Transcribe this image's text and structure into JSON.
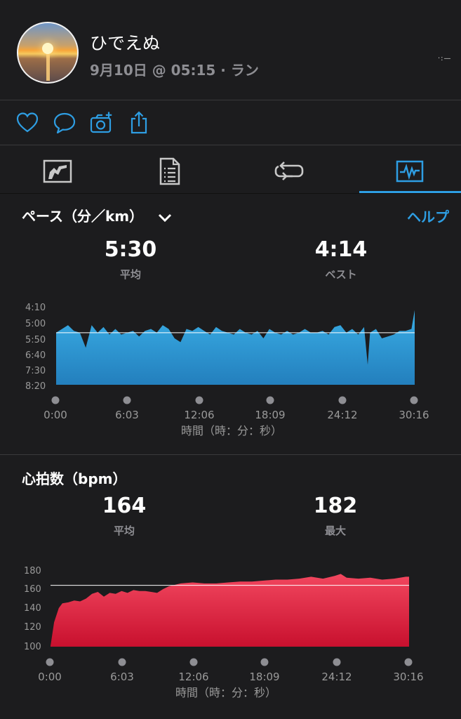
{
  "profile": {
    "name": "ひでえぬ",
    "meta": "9月10日 @ 05:15 · ラン",
    "more": "·:—"
  },
  "actions": [
    "heart-icon",
    "comment-icon",
    "add-photo-icon",
    "share-icon"
  ],
  "tabs": [
    {
      "icon": "map-summary-icon",
      "selected": false
    },
    {
      "icon": "details-icon",
      "selected": false
    },
    {
      "icon": "laps-icon",
      "selected": false
    },
    {
      "icon": "charts-icon",
      "selected": true
    }
  ],
  "colors": {
    "accent": "#2e9ee3",
    "pace": "#2f9fd6",
    "heart": "#e8304e"
  },
  "pace": {
    "title": "ペース（分／km）",
    "help": "ヘルプ",
    "avg_value": "5:30",
    "avg_label": "平均",
    "best_value": "4:14",
    "best_label": "ベスト"
  },
  "heart": {
    "title": "心拍数（bpm）",
    "avg_value": "164",
    "avg_label": "平均",
    "max_value": "182",
    "max_label": "最大"
  },
  "chart_data": [
    {
      "type": "area",
      "title": "ペース（分／km）",
      "y_tick_labels": [
        "4:10",
        "5:00",
        "5:50",
        "6:40",
        "7:30",
        "8:20"
      ],
      "x_tick_labels": [
        "0:00",
        "6:03",
        "12:06",
        "18:09",
        "24:12",
        "30:16"
      ],
      "xlabel": "時間（時：分：秒）",
      "average_line": "5:30",
      "x": [
        0,
        0.5,
        1,
        1.5,
        2,
        2.5,
        3,
        3.5,
        4,
        4.5,
        5,
        5.5,
        6,
        6.5,
        7,
        7.5,
        8,
        8.5,
        9,
        9.5,
        10,
        10.5,
        11,
        11.5,
        12,
        12.5,
        13,
        13.5,
        14,
        14.5,
        15,
        15.5,
        16,
        16.5,
        17,
        17.5,
        18,
        18.5,
        19,
        19.5,
        20,
        20.5,
        21,
        21.5,
        22,
        22.5,
        23,
        23.5,
        24,
        24.5,
        25,
        25.5,
        26,
        26.3,
        26.5,
        27,
        27.5,
        28,
        28.5,
        29,
        29.5,
        30,
        30.27
      ],
      "y_minutes_per_km": [
        5.5,
        5.3,
        5.1,
        5.4,
        5.5,
        6.3,
        5.1,
        5.5,
        5.2,
        5.6,
        5.3,
        5.6,
        5.5,
        5.4,
        5.7,
        5.4,
        5.3,
        5.5,
        5.1,
        5.3,
        5.8,
        6.0,
        5.3,
        5.4,
        5.2,
        5.4,
        5.6,
        5.2,
        5.4,
        5.5,
        5.6,
        5.3,
        5.5,
        5.6,
        5.4,
        5.8,
        5.3,
        5.5,
        5.6,
        5.4,
        5.6,
        5.5,
        5.3,
        5.5,
        5.5,
        5.4,
        5.6,
        5.2,
        5.1,
        5.5,
        5.3,
        5.6,
        5.2,
        7.2,
        5.5,
        5.3,
        5.8,
        5.7,
        5.6,
        5.4,
        5.4,
        5.3,
        4.3
      ]
    },
    {
      "type": "area",
      "title": "心拍数（bpm）",
      "y_tick_labels": [
        "180",
        "160",
        "140",
        "120",
        "100"
      ],
      "ylim": [
        100,
        180
      ],
      "x_tick_labels": [
        "0:00",
        "6:03",
        "12:06",
        "18:09",
        "24:12",
        "30:16"
      ],
      "xlabel": "時間（時：分：秒）",
      "average_line": 164,
      "x": [
        0,
        0.3,
        0.7,
        1,
        1.5,
        2,
        2.5,
        3,
        3.5,
        4,
        4.5,
        5,
        5.5,
        6,
        6.5,
        7,
        7.5,
        8,
        8.5,
        9,
        9.5,
        10,
        11,
        12,
        13,
        14,
        15,
        16,
        17,
        18,
        19,
        20,
        21,
        22,
        23,
        24,
        24.5,
        25,
        26,
        27,
        28,
        29,
        30,
        30.27
      ],
      "y": [
        100,
        125,
        140,
        145,
        146,
        148,
        147,
        150,
        155,
        157,
        152,
        156,
        155,
        158,
        156,
        159,
        158,
        158,
        157,
        156,
        160,
        163,
        166,
        167,
        166,
        166,
        167,
        168,
        168,
        169,
        170,
        170,
        171,
        173,
        171,
        174,
        176,
        172,
        171,
        172,
        170,
        171,
        173,
        173
      ]
    }
  ],
  "pace_axis": {
    "y_ticks": [
      "4:10",
      "5:00",
      "5:50",
      "6:40",
      "7:30",
      "8:20"
    ],
    "x_ticks": [
      "0:00",
      "6:03",
      "12:06",
      "18:09",
      "24:12",
      "30:16"
    ],
    "xlabel": "時間（時：分：秒）"
  },
  "heart_axis": {
    "y_ticks": [
      "180",
      "160",
      "140",
      "120",
      "100"
    ],
    "x_ticks": [
      "0:00",
      "6:03",
      "12:06",
      "18:09",
      "24:12",
      "30:16"
    ],
    "xlabel": "時間（時：分：秒）"
  }
}
